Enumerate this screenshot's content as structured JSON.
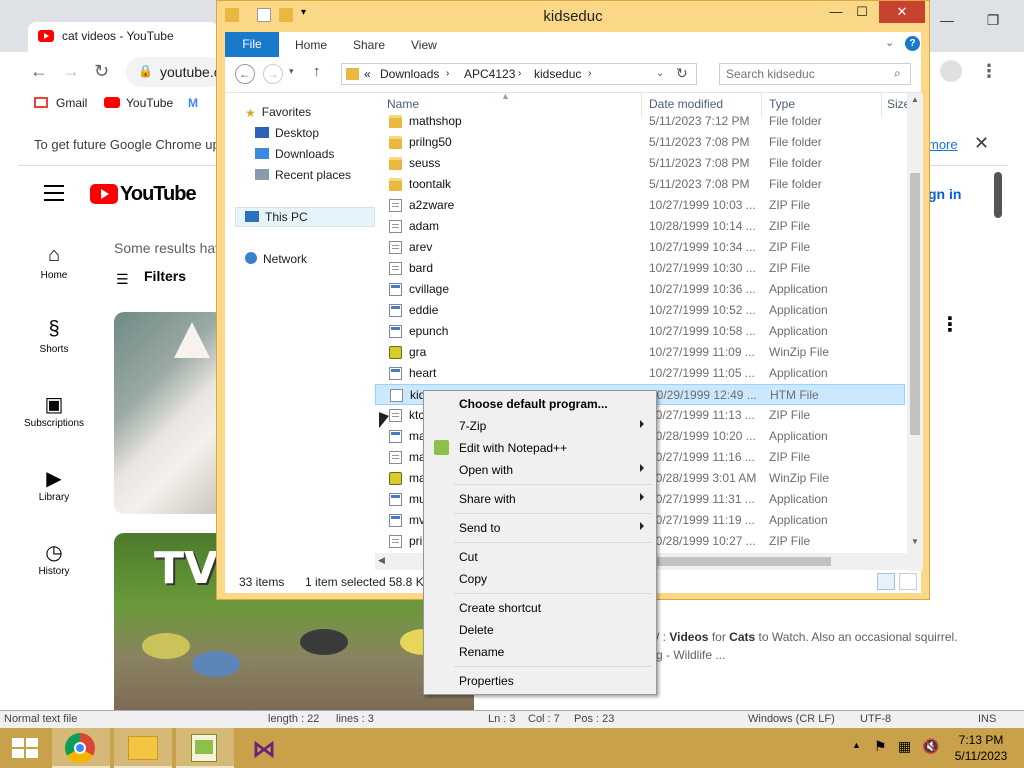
{
  "chrome": {
    "tab_title": "cat videos - YouTube",
    "url": "youtube.c",
    "bookmarks": [
      {
        "label": "Gmail"
      },
      {
        "label": "YouTube"
      },
      {
        "label": "M"
      }
    ],
    "infobar_text": "To get future Google Chrome up",
    "infobar_more": "more",
    "window_controls": {
      "minimize": "—",
      "restore": "❐",
      "close": "✕"
    }
  },
  "youtube": {
    "logo_text": "YouTube",
    "sidebar": [
      {
        "label": "Home",
        "icon": "home-icon"
      },
      {
        "label": "Shorts",
        "icon": "shorts-icon"
      },
      {
        "label": "Subscriptions",
        "icon": "subscriptions-icon"
      },
      {
        "label": "Library",
        "icon": "library-icon"
      },
      {
        "label": "History",
        "icon": "history-icon"
      }
    ],
    "results_text": "Some results hav",
    "filters_label": "Filters",
    "sign_in": "gn in",
    "thumb2_text": "TV",
    "desc_line1": {
      "pre": "/ : ",
      "b1": "Videos",
      "mid1": " for ",
      "b2": "Cats",
      "mid2": " to Watch. Also an occasional squirrel."
    },
    "desc_line2": "g - Wildlife ..."
  },
  "npp_status": {
    "mode": "Normal text file",
    "length": "length : 22",
    "lines": "lines : 3",
    "ln": "Ln : 3",
    "col": "Col : 7",
    "pos": "Pos : 23",
    "eol": "Windows (CR LF)",
    "enc": "UTF-8",
    "ins": "INS"
  },
  "explorer": {
    "title": "kidseduc",
    "controls": {
      "minimize": "—",
      "maximize": "☐",
      "close": "✕"
    },
    "ribbon_tabs": {
      "file": "File",
      "home": "Home",
      "share": "Share",
      "view": "View"
    },
    "address": {
      "prefix": "«",
      "crumbs": [
        "Downloads",
        "APC4123",
        "kidseduc"
      ]
    },
    "search_placeholder": "Search kidseduc",
    "nav": {
      "favorites": "Favorites",
      "desktop": "Desktop",
      "downloads": "Downloads",
      "recent": "Recent places",
      "this_pc": "This PC",
      "network": "Network"
    },
    "columns": {
      "name": "Name",
      "date": "Date modified",
      "type": "Type",
      "size": "Size"
    },
    "files": [
      {
        "name": "mathshop",
        "date": "5/11/2023 7:12 PM",
        "type": "File folder",
        "icon": "folder"
      },
      {
        "name": "prilng50",
        "date": "5/11/2023 7:08 PM",
        "type": "File folder",
        "icon": "folder"
      },
      {
        "name": "seuss",
        "date": "5/11/2023 7:08 PM",
        "type": "File folder",
        "icon": "folder"
      },
      {
        "name": "toontalk",
        "date": "5/11/2023 7:08 PM",
        "type": "File folder",
        "icon": "folder"
      },
      {
        "name": "a2zware",
        "date": "10/27/1999 10:03 ...",
        "type": "ZIP File",
        "icon": "zip"
      },
      {
        "name": "adam",
        "date": "10/28/1999 10:14 ...",
        "type": "ZIP File",
        "icon": "zip"
      },
      {
        "name": "arev",
        "date": "10/27/1999 10:34 ...",
        "type": "ZIP File",
        "icon": "zip"
      },
      {
        "name": "bard",
        "date": "10/27/1999 10:30 ...",
        "type": "ZIP File",
        "icon": "zip"
      },
      {
        "name": "cvillage",
        "date": "10/27/1999 10:36 ...",
        "type": "Application",
        "icon": "app"
      },
      {
        "name": "eddie",
        "date": "10/27/1999 10:52 ...",
        "type": "Application",
        "icon": "app"
      },
      {
        "name": "epunch",
        "date": "10/27/1999 10:58 ...",
        "type": "Application",
        "icon": "app"
      },
      {
        "name": "gra",
        "date": "10/27/1999 11:09 ...",
        "type": "WinZip File",
        "icon": "winzip"
      },
      {
        "name": "heart",
        "date": "10/27/1999 11:05 ...",
        "type": "Application",
        "icon": "app"
      },
      {
        "name": "kid",
        "date": "10/29/1999 12:49 ...",
        "type": "HTM File",
        "icon": "htm"
      },
      {
        "name": "ktc",
        "date": "10/27/1999 11:13 ...",
        "type": "ZIP File",
        "icon": "zip"
      },
      {
        "name": "ma",
        "date": "10/28/1999 10:20 ...",
        "type": "Application",
        "icon": "app"
      },
      {
        "name": "ma",
        "date": "10/27/1999 11:16 ...",
        "type": "ZIP File",
        "icon": "zip"
      },
      {
        "name": "ma",
        "date": "10/28/1999 3:01 AM",
        "type": "WinZip File",
        "icon": "winzip"
      },
      {
        "name": "mu",
        "date": "10/27/1999 11:31 ...",
        "type": "Application",
        "icon": "app"
      },
      {
        "name": "mv",
        "date": "10/27/1999 11:19 ...",
        "type": "Application",
        "icon": "app"
      },
      {
        "name": "pri",
        "date": "10/28/1999 10:27 ...",
        "type": "ZIP File",
        "icon": "zip"
      }
    ],
    "selected_index": 13,
    "status": {
      "items": "33 items",
      "selected": "1 item selected",
      "size": "58.8 KB"
    }
  },
  "context_menu": {
    "items": [
      {
        "label": "Choose default program...",
        "bold": true
      },
      {
        "label": "7-Zip",
        "submenu": true
      },
      {
        "label": "Edit with Notepad++",
        "icon": "notepadpp-icon"
      },
      {
        "label": "Open with",
        "submenu": true
      },
      {
        "label": "Share with",
        "submenu": true
      },
      {
        "label": "Send to",
        "submenu": true
      },
      {
        "label": "Cut"
      },
      {
        "label": "Copy"
      },
      {
        "label": "Create shortcut"
      },
      {
        "label": "Delete"
      },
      {
        "label": "Rename"
      },
      {
        "label": "Properties"
      }
    ]
  },
  "taskbar": {
    "clock_time": "7:13 PM",
    "clock_date": "5/11/2023"
  },
  "colors": {
    "explorer_frame": "#fbd887",
    "taskbar": "#c9a14a",
    "ribbon_file": "#1979ca",
    "selection": "#cce8ff",
    "youtube_red": "#ff0000"
  }
}
